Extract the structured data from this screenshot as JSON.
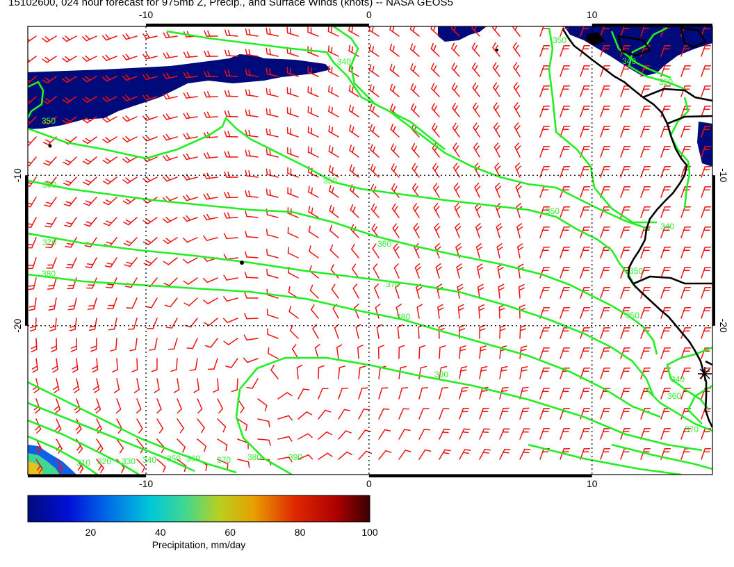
{
  "title": "15102600, 024 hour forecast for 975mb Z, Precip., and Surface Winds (knots) -- NASA GEOS5",
  "map": {
    "x_ticks": [
      "-10",
      "0",
      "10"
    ],
    "y_ticks": [
      "-10",
      "-20"
    ],
    "x_range": [
      -15.3,
      15.4
    ],
    "y_range": [
      -29.9,
      -0.1
    ],
    "colors": {
      "contour": "#22ee22",
      "barb": "#ee1111",
      "precip_low": "#000a7a",
      "precip_high": "#3a0000",
      "coast": "#000000",
      "grid": "#000000"
    },
    "contour_labels": [
      "310",
      "320",
      "330",
      "340",
      "350",
      "360",
      "370",
      "380",
      "390"
    ]
  },
  "colorbar": {
    "title": "Precipitation, mm/day",
    "ticks": [
      "20",
      "40",
      "60",
      "80",
      "100"
    ],
    "range": [
      2,
      100
    ]
  }
}
